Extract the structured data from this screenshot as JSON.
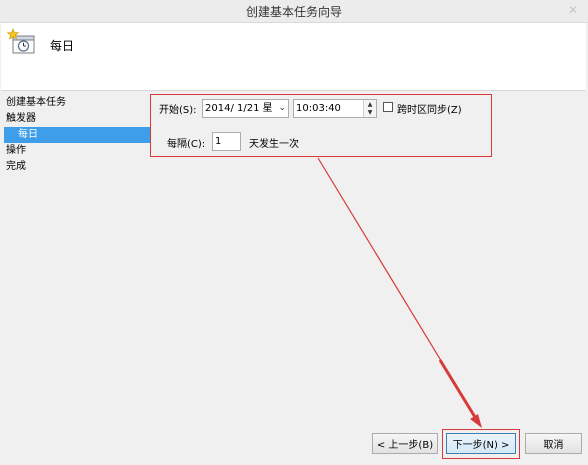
{
  "window": {
    "title": "创建基本任务向导",
    "close_glyph": "✕"
  },
  "header": {
    "title": "每日",
    "icon": "task-clock-icon"
  },
  "sidebar": {
    "items": [
      {
        "label": "创建基本任务"
      },
      {
        "label": "触发器"
      },
      {
        "label": "每日",
        "selected": true
      },
      {
        "label": "操作"
      },
      {
        "label": "完成"
      }
    ]
  },
  "form": {
    "start_label": "开始(S):",
    "date_value": "2014/  1/21 星",
    "time_value": "10:03:40",
    "sync_label": "跨时区同步(Z)",
    "sync_checked": false,
    "every_label": "每隔(C):",
    "every_value": "1",
    "every_suffix": "天发生一次"
  },
  "buttons": {
    "back": "< 上一步(B)",
    "next": "下一步(N) >",
    "cancel": "取消"
  },
  "colors": {
    "annotation": "#d63a3a",
    "selected": "#3f9ee9"
  }
}
